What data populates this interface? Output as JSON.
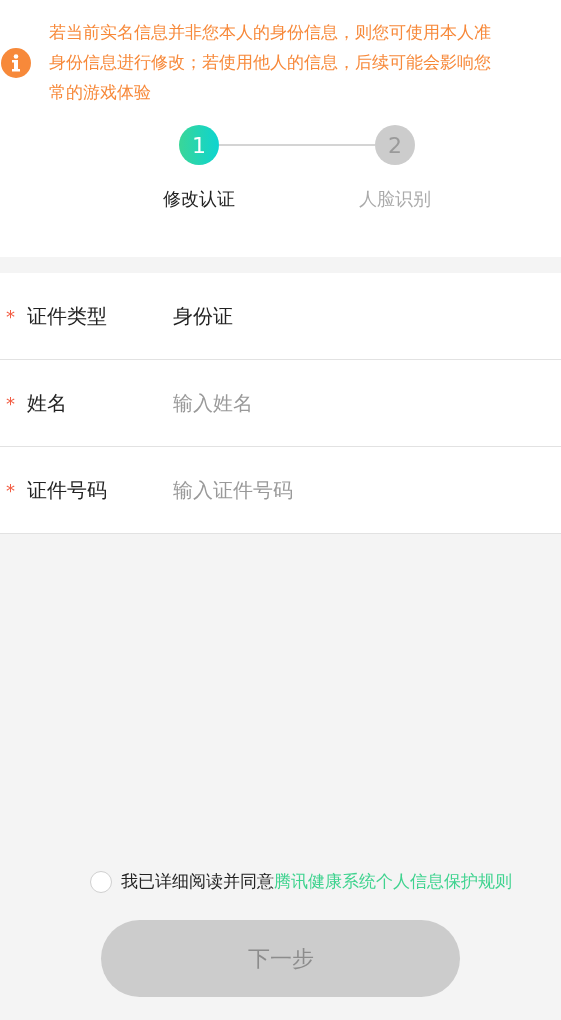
{
  "notice": {
    "lines": [
      "若当前实名信息并非您本人的身份信息，则您可使用本人准",
      "身份信息进行修改；若使用他人的信息，后续可能会影响您",
      "常的游戏体验"
    ]
  },
  "steps": [
    {
      "number": "1",
      "label": "修改认证",
      "selected": true
    },
    {
      "number": "2",
      "label": "人脸识别",
      "selected": false
    }
  ],
  "fields": [
    {
      "mark": "*",
      "label": "证件类型",
      "value": "身份证"
    },
    {
      "mark": "*",
      "label": "姓名",
      "placeholder": "输入姓名"
    },
    {
      "mark": "*",
      "label": "证件号码",
      "placeholder": "输入证件号码"
    }
  ],
  "agreement": {
    "checked": false,
    "text": "我已详细阅读并同意",
    "link": "腾讯健康系统个人信息保护规则"
  },
  "next_button": {
    "label": "下一步",
    "disabled": true
  }
}
